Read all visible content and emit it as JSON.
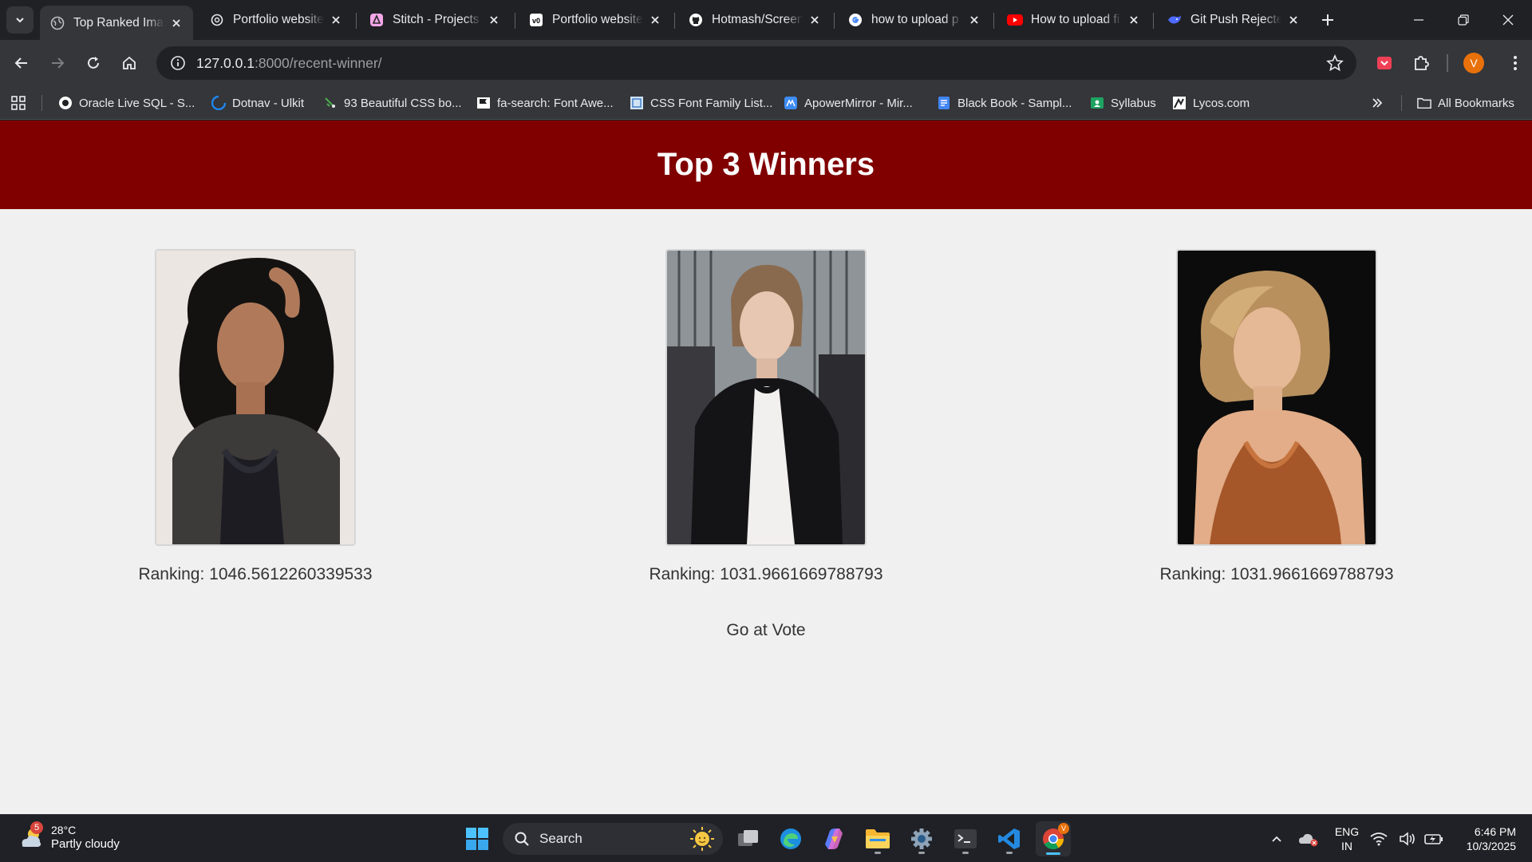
{
  "browser": {
    "tabs": [
      {
        "title": "Top Ranked Images",
        "icon": "globe-icon",
        "active": true
      },
      {
        "title": "Portfolio website",
        "icon": "openai-icon"
      },
      {
        "title": "Stitch - Projects",
        "icon": "stitch-icon"
      },
      {
        "title": "Portfolio website",
        "icon": "v0-icon"
      },
      {
        "title": "Hotmash/Screen",
        "icon": "github-icon"
      },
      {
        "title": "how to upload p",
        "icon": "google-icon"
      },
      {
        "title": "How to upload fi",
        "icon": "youtube-icon"
      },
      {
        "title": "Git Push Rejected",
        "icon": "deepseek-icon"
      }
    ],
    "url_host": "127.0.0.1",
    "url_path": ":8000/recent-winner/",
    "profile_initial": "V",
    "bookmarks": [
      {
        "label": "Oracle Live SQL - S...",
        "icon": "oracle-icon"
      },
      {
        "label": "Dotnav - Ulkit",
        "icon": "uikit-icon"
      },
      {
        "label": "93 Beautiful CSS bo...",
        "icon": "css-icon"
      },
      {
        "label": "fa-search: Font Awe...",
        "icon": "flag-icon"
      },
      {
        "label": "CSS Font Family List...",
        "icon": "font-icon"
      },
      {
        "label": "ApowerMirror - Mir...",
        "icon": "apower-icon"
      },
      {
        "label": "Black Book - Sampl...",
        "icon": "docs-icon"
      },
      {
        "label": "Syllabus",
        "icon": "classroom-icon"
      },
      {
        "label": "Lycos.com",
        "icon": "lycos-icon"
      }
    ],
    "all_bookmarks": "All Bookmarks"
  },
  "page": {
    "title": "Top 3 Winners",
    "winners": [
      {
        "ranking": "Ranking: 1046.5612260339533"
      },
      {
        "ranking": "Ranking: 1031.9661669788793"
      },
      {
        "ranking": "Ranking: 1031.9661669788793"
      }
    ],
    "vote_link": "Go at Vote"
  },
  "taskbar": {
    "weather_temp": "28°C",
    "weather_desc": "Partly cloudy",
    "weather_badge": "5",
    "search_placeholder": "Search",
    "lang_top": "ENG",
    "lang_bottom": "IN",
    "time": "6:46 PM",
    "date": "10/3/2025"
  },
  "colors": {
    "header_bg": "#800000",
    "page_bg": "#f0f0f0",
    "browser_dark": "#202124",
    "toolbar": "#35363a"
  }
}
